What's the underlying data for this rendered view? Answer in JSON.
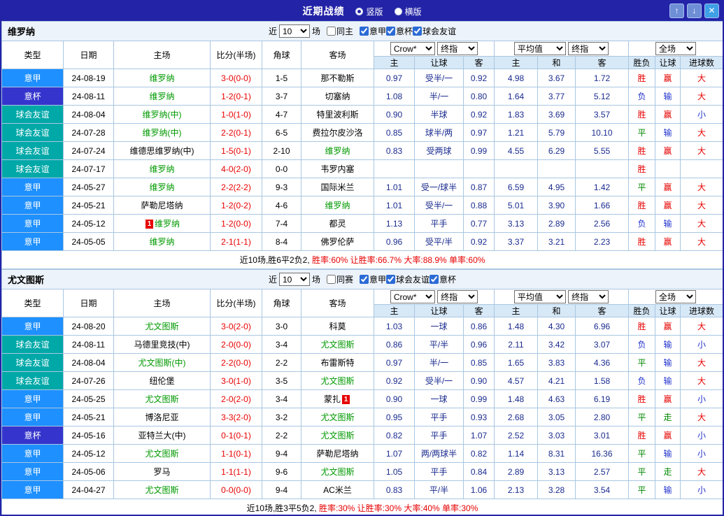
{
  "titlebar": {
    "title": "近期战绩",
    "view_options": [
      {
        "label": "竖版",
        "selected": true
      },
      {
        "label": "横版",
        "selected": false
      }
    ],
    "buttons": {
      "up": "↑",
      "down": "↓",
      "close": "✕"
    }
  },
  "palette": {
    "league_colors": {
      "意甲": "#1E90FF",
      "意杯": "#3535CD",
      "球会友谊": "#00A8A8"
    },
    "result_colors": {
      "胜": "#E60000",
      "负": "#2233CC",
      "平": "#008800",
      "赢": "#E60000",
      "输": "#2233CC",
      "走": "#008800",
      "大": "#E60000",
      "小": "#2233CC"
    }
  },
  "columns": [
    "类型",
    "日期",
    "主场",
    "比分(半场)",
    "角球",
    "客场",
    "主",
    "让球",
    "客",
    "主",
    "和",
    "客",
    "胜负",
    "让球",
    "进球数"
  ],
  "sections": [
    {
      "team": "维罗纳",
      "filter": {
        "near": "近",
        "count": "10",
        "games": "场",
        "same_option": {
          "label": "同主",
          "checked": false
        },
        "league_options": [
          {
            "label": "意甲",
            "checked": true
          },
          {
            "label": "意杯",
            "checked": true
          },
          {
            "label": "球会友谊",
            "checked": true
          }
        ]
      },
      "dropdowns": {
        "odds_source": "Crow*",
        "odds_stage": "终指",
        "avg_source": "平均值",
        "avg_stage": "终指",
        "scope": "全场"
      },
      "rows": [
        {
          "type": "意甲",
          "date": "24-08-19",
          "home": "维罗纳",
          "home_green": true,
          "away": "那不勒斯",
          "away_green": false,
          "score": "3-0(0-0)",
          "corners": "1-5",
          "odds": [
            "0.97",
            "受半/一",
            "0.92"
          ],
          "avg": [
            "4.98",
            "3.67",
            "1.72"
          ],
          "result": "胜",
          "asian": "赢",
          "goals": "大"
        },
        {
          "type": "意杯",
          "date": "24-08-11",
          "home": "维罗纳",
          "home_green": true,
          "away": "切塞纳",
          "away_green": false,
          "score": "1-2(0-1)",
          "corners": "3-7",
          "odds": [
            "1.08",
            "半/一",
            "0.80"
          ],
          "avg": [
            "1.64",
            "3.77",
            "5.12"
          ],
          "result": "负",
          "asian": "输",
          "goals": "大"
        },
        {
          "type": "球会友谊",
          "date": "24-08-04",
          "home": "维罗纳(中)",
          "home_green": true,
          "away": "特里波利斯",
          "away_green": false,
          "score": "1-0(1-0)",
          "corners": "4-7",
          "odds": [
            "0.90",
            "半球",
            "0.92"
          ],
          "avg": [
            "1.83",
            "3.69",
            "3.57"
          ],
          "result": "胜",
          "asian": "赢",
          "goals": "小"
        },
        {
          "type": "球会友谊",
          "date": "24-07-28",
          "home": "维罗纳(中)",
          "home_green": true,
          "away": "费拉尔皮沙洛",
          "away_green": false,
          "score": "2-2(0-1)",
          "corners": "6-5",
          "odds": [
            "0.85",
            "球半/两",
            "0.97"
          ],
          "avg": [
            "1.21",
            "5.79",
            "10.10"
          ],
          "result": "平",
          "asian": "输",
          "goals": "大"
        },
        {
          "type": "球会友谊",
          "date": "24-07-24",
          "home": "维德思维罗纳(中)",
          "home_green": false,
          "away": "维罗纳",
          "away_green": true,
          "score": "1-5(0-1)",
          "corners": "2-10",
          "odds": [
            "0.83",
            "受两球",
            "0.99"
          ],
          "avg": [
            "4.55",
            "6.29",
            "5.55"
          ],
          "result": "胜",
          "asian": "赢",
          "goals": "大"
        },
        {
          "type": "球会友谊",
          "date": "24-07-17",
          "home": "维罗纳",
          "home_green": true,
          "away": "韦罗内塞",
          "away_green": false,
          "score": "4-0(2-0)",
          "corners": "0-0",
          "odds": [
            "",
            "",
            ""
          ],
          "avg": [
            "",
            "",
            ""
          ],
          "result": "胜",
          "asian": "",
          "goals": ""
        },
        {
          "type": "意甲",
          "date": "24-05-27",
          "home": "维罗纳",
          "home_green": true,
          "away": "国际米兰",
          "away_green": false,
          "score": "2-2(2-2)",
          "corners": "9-3",
          "odds": [
            "1.01",
            "受一/球半",
            "0.87"
          ],
          "avg": [
            "6.59",
            "4.95",
            "1.42"
          ],
          "result": "平",
          "asian": "赢",
          "goals": "大"
        },
        {
          "type": "意甲",
          "date": "24-05-21",
          "home": "萨勒尼塔纳",
          "home_green": false,
          "away": "维罗纳",
          "away_green": true,
          "score": "1-2(0-2)",
          "corners": "4-6",
          "odds": [
            "1.01",
            "受半/一",
            "0.88"
          ],
          "avg": [
            "5.01",
            "3.90",
            "1.66"
          ],
          "result": "胜",
          "asian": "赢",
          "goals": "大"
        },
        {
          "type": "意甲",
          "date": "24-05-12",
          "home": "维罗纳",
          "home_green": true,
          "home_badge": {
            "text": "1",
            "side": "left"
          },
          "away": "都灵",
          "away_green": false,
          "score": "1-2(0-0)",
          "corners": "7-4",
          "odds": [
            "1.13",
            "平手",
            "0.77"
          ],
          "avg": [
            "3.13",
            "2.89",
            "2.56"
          ],
          "result": "负",
          "asian": "输",
          "goals": "大"
        },
        {
          "type": "意甲",
          "date": "24-05-05",
          "home": "维罗纳",
          "home_green": true,
          "away": "佛罗伦萨",
          "away_green": false,
          "score": "2-1(1-1)",
          "corners": "8-4",
          "odds": [
            "0.96",
            "受平/半",
            "0.92"
          ],
          "avg": [
            "3.37",
            "3.21",
            "2.23"
          ],
          "result": "胜",
          "asian": "赢",
          "goals": "大"
        }
      ],
      "summary_prefix": "近10场,胜6平2负2, ",
      "summary_stats": "胜率:60% 让胜率:66.7% 大率:88.9% 单率:60%"
    },
    {
      "team": "尤文图斯",
      "filter": {
        "near": "近",
        "count": "10",
        "games": "场",
        "same_option": {
          "label": "同赛",
          "checked": false
        },
        "league_options": [
          {
            "label": "意甲",
            "checked": true
          },
          {
            "label": "球会友谊",
            "checked": true
          },
          {
            "label": "意杯",
            "checked": true
          }
        ]
      },
      "dropdowns": {
        "odds_source": "Crow*",
        "odds_stage": "终指",
        "avg_source": "平均值",
        "avg_stage": "终指",
        "scope": "全场"
      },
      "rows": [
        {
          "type": "意甲",
          "date": "24-08-20",
          "home": "尤文图斯",
          "home_green": true,
          "away": "科莫",
          "away_green": false,
          "score": "3-0(2-0)",
          "corners": "3-0",
          "odds": [
            "1.03",
            "一球",
            "0.86"
          ],
          "avg": [
            "1.48",
            "4.30",
            "6.96"
          ],
          "result": "胜",
          "asian": "赢",
          "goals": "大"
        },
        {
          "type": "球会友谊",
          "date": "24-08-11",
          "home": "马德里竞技(中)",
          "home_green": false,
          "away": "尤文图斯",
          "away_green": true,
          "score": "2-0(0-0)",
          "corners": "3-4",
          "odds": [
            "0.86",
            "平/半",
            "0.96"
          ],
          "avg": [
            "2.11",
            "3.42",
            "3.07"
          ],
          "result": "负",
          "asian": "输",
          "goals": "小"
        },
        {
          "type": "球会友谊",
          "date": "24-08-04",
          "home": "尤文图斯(中)",
          "home_green": true,
          "away": "布雷斯特",
          "away_green": false,
          "score": "2-2(0-0)",
          "corners": "2-2",
          "odds": [
            "0.97",
            "半/一",
            "0.85"
          ],
          "avg": [
            "1.65",
            "3.83",
            "4.36"
          ],
          "result": "平",
          "asian": "输",
          "goals": "大"
        },
        {
          "type": "球会友谊",
          "date": "24-07-26",
          "home": "纽伦堡",
          "home_green": false,
          "away": "尤文图斯",
          "away_green": true,
          "score": "3-0(1-0)",
          "corners": "3-5",
          "odds": [
            "0.92",
            "受半/一",
            "0.90"
          ],
          "avg": [
            "4.57",
            "4.21",
            "1.58"
          ],
          "result": "负",
          "asian": "输",
          "goals": "大"
        },
        {
          "type": "意甲",
          "date": "24-05-25",
          "home": "尤文图斯",
          "home_green": true,
          "away": "蒙扎",
          "away_green": false,
          "away_badge": {
            "text": "1",
            "side": "right"
          },
          "score": "2-0(2-0)",
          "corners": "3-4",
          "odds": [
            "0.90",
            "一球",
            "0.99"
          ],
          "avg": [
            "1.48",
            "4.63",
            "6.19"
          ],
          "result": "胜",
          "asian": "赢",
          "goals": "小"
        },
        {
          "type": "意甲",
          "date": "24-05-21",
          "home": "博洛尼亚",
          "home_green": false,
          "away": "尤文图斯",
          "away_green": true,
          "score": "3-3(2-0)",
          "corners": "3-2",
          "odds": [
            "0.95",
            "平手",
            "0.93"
          ],
          "avg": [
            "2.68",
            "3.05",
            "2.80"
          ],
          "result": "平",
          "asian": "走",
          "goals": "大"
        },
        {
          "type": "意杯",
          "date": "24-05-16",
          "home": "亚特兰大(中)",
          "home_green": false,
          "away": "尤文图斯",
          "away_green": true,
          "score": "0-1(0-1)",
          "corners": "2-2",
          "odds": [
            "0.82",
            "平手",
            "1.07"
          ],
          "avg": [
            "2.52",
            "3.03",
            "3.01"
          ],
          "result": "胜",
          "asian": "赢",
          "goals": "小"
        },
        {
          "type": "意甲",
          "date": "24-05-12",
          "home": "尤文图斯",
          "home_green": true,
          "away": "萨勒尼塔纳",
          "away_green": false,
          "score": "1-1(0-1)",
          "corners": "9-4",
          "odds": [
            "1.07",
            "两/两球半",
            "0.82"
          ],
          "avg": [
            "1.14",
            "8.31",
            "16.36"
          ],
          "result": "平",
          "asian": "输",
          "goals": "小"
        },
        {
          "type": "意甲",
          "date": "24-05-06",
          "home": "罗马",
          "home_green": false,
          "away": "尤文图斯",
          "away_green": true,
          "score": "1-1(1-1)",
          "corners": "9-6",
          "odds": [
            "1.05",
            "平手",
            "0.84"
          ],
          "avg": [
            "2.89",
            "3.13",
            "2.57"
          ],
          "result": "平",
          "asian": "走",
          "goals": "大"
        },
        {
          "type": "意甲",
          "date": "24-04-27",
          "home": "尤文图斯",
          "home_green": true,
          "away": "AC米兰",
          "away_green": false,
          "score": "0-0(0-0)",
          "corners": "9-4",
          "odds": [
            "0.83",
            "平/半",
            "1.06"
          ],
          "avg": [
            "2.13",
            "3.28",
            "3.54"
          ],
          "result": "平",
          "asian": "输",
          "goals": "小"
        }
      ],
      "summary_prefix": "近10场,胜3平5负2, ",
      "summary_stats": "胜率:30% 让胜率:30% 大率:40% 单率:30%"
    }
  ]
}
